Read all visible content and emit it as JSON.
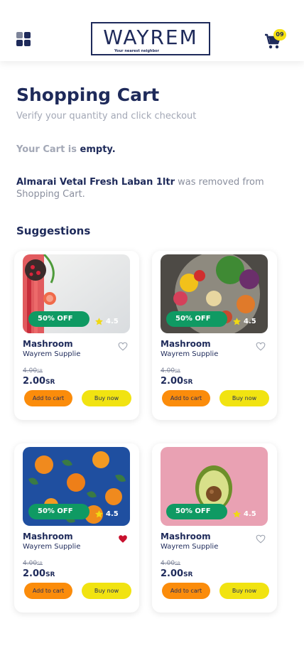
{
  "header": {
    "logo_text": "WAYREM",
    "logo_tagline": "Your nearest neighbor",
    "cart_count": "09"
  },
  "page": {
    "title": "Shopping Cart",
    "subtitle": "Verify your quantity and click checkout",
    "empty_prefix": "Your Cart is",
    "empty_word": "empty.",
    "removed_product": "Almarai Vetal Fresh Laban 1ltr",
    "removed_suffix": "was removed from Shopping Cart.",
    "suggestions_title": "Suggestions"
  },
  "products": [
    {
      "discount": "50% OFF",
      "rating": "4.5",
      "name": "Mashroom",
      "supplier": "Wayrem Supplie",
      "old_price": "4.00",
      "new_price": "2.00",
      "currency": "SR",
      "favorite": false,
      "image": "vegetables-flatlay",
      "add_label": "Add to cart",
      "buy_label": "Buy now"
    },
    {
      "discount": "50% OFF",
      "rating": "4.5",
      "name": "Mashroom",
      "supplier": "Wayrem Supplie",
      "old_price": "4.00",
      "new_price": "2.00",
      "currency": "SR",
      "favorite": false,
      "image": "salad-bowl",
      "add_label": "Add to cart",
      "buy_label": "Buy now"
    },
    {
      "discount": "50% OFF",
      "rating": "4.5",
      "name": "Mashroom",
      "supplier": "Wayrem Supplie",
      "old_price": "4.00",
      "new_price": "2.00",
      "currency": "SR",
      "favorite": true,
      "image": "tangerines-blue",
      "add_label": "Add to cart",
      "buy_label": "Buy now"
    },
    {
      "discount": "50% OFF",
      "rating": "4.5",
      "name": "Mashroom",
      "supplier": "Wayrem Supplie",
      "old_price": "4.00",
      "new_price": "2.00",
      "currency": "SR",
      "favorite": false,
      "image": "avocado-pink",
      "add_label": "Add to cart",
      "buy_label": "Buy now"
    }
  ],
  "colors": {
    "primary": "#1e2a5a",
    "muted": "#a3a8b6",
    "discount_badge": "#0f9a63",
    "add_button": "#fb8c0b",
    "buy_button": "#f1e311",
    "cart_badge": "#f5e112",
    "favorite": "#c8102e"
  }
}
